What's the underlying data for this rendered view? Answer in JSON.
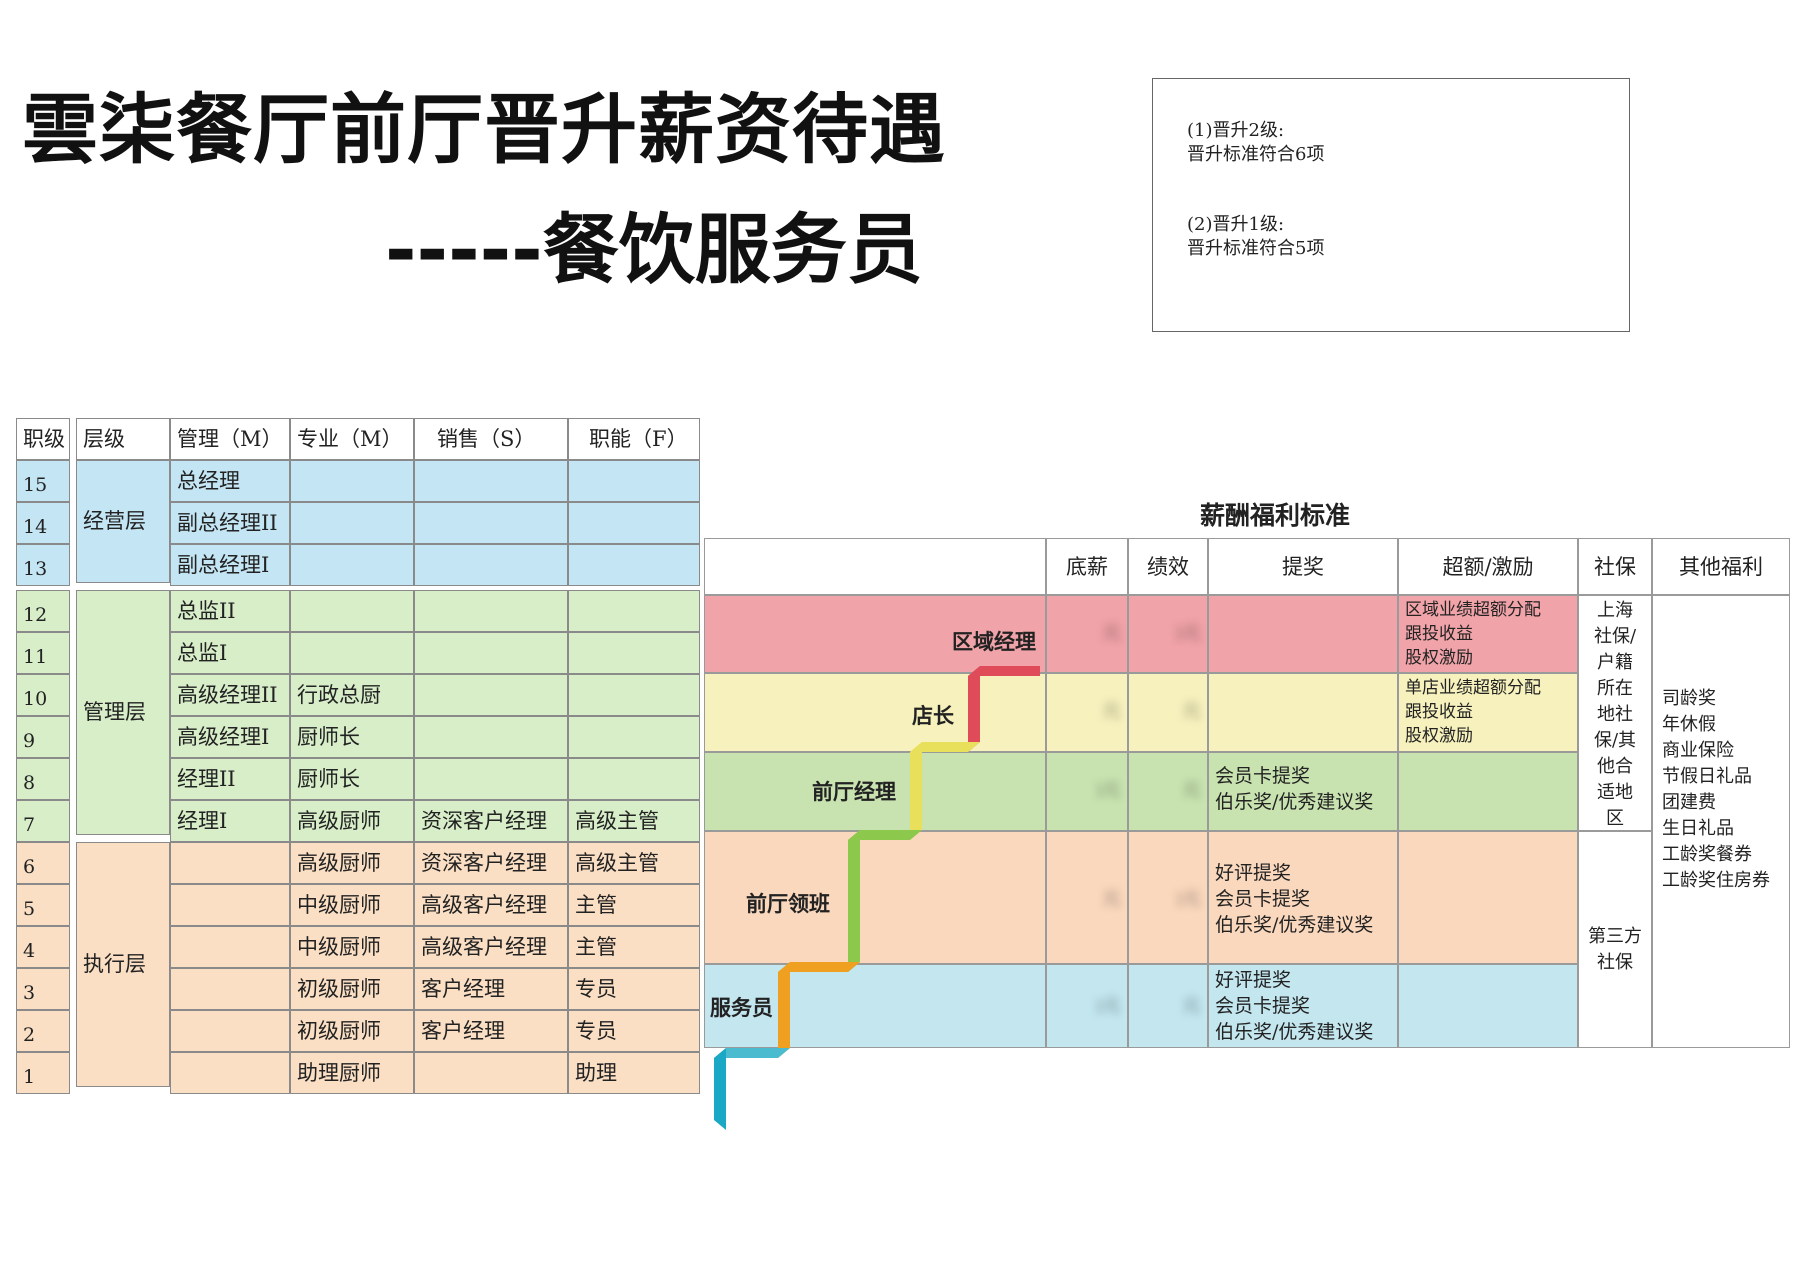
{
  "title": {
    "line1": "雲柒餐厅前厅晋升薪资待遇",
    "line2": "-----餐饮服务员"
  },
  "notes": {
    "note1": "(1)晋升2级:\n晋升标准符合6项",
    "note2": "(2)晋升1级:\n晋升标准符合5项"
  },
  "grade_table": {
    "headers": [
      "职级",
      "层级",
      "管理（M）",
      "专业（M）",
      "销售（S）",
      "职能（F）"
    ],
    "groups": [
      {
        "name": "经营层",
        "color": "blue"
      },
      {
        "name": "管理层",
        "color": "green"
      },
      {
        "name": "执行层",
        "color": "peach"
      }
    ],
    "rows": [
      {
        "grade": "15",
        "m": "总经理",
        "p": "",
        "s": "",
        "f": ""
      },
      {
        "grade": "14",
        "m": "副总经理II",
        "p": "",
        "s": "",
        "f": ""
      },
      {
        "grade": "13",
        "m": "副总经理I",
        "p": "",
        "s": "",
        "f": ""
      },
      {
        "grade": "12",
        "m": "总监II",
        "p": "",
        "s": "",
        "f": ""
      },
      {
        "grade": "11",
        "m": "总监I",
        "p": "",
        "s": "",
        "f": ""
      },
      {
        "grade": "10",
        "m": "高级经理II",
        "p": "行政总厨",
        "s": "",
        "f": ""
      },
      {
        "grade": "9",
        "m": "高级经理I",
        "p": "厨师长",
        "s": "",
        "f": ""
      },
      {
        "grade": "8",
        "m": "经理II",
        "p": "厨师长",
        "s": "",
        "f": ""
      },
      {
        "grade": "7",
        "m": "经理I",
        "p": "高级厨师",
        "s": "资深客户经理",
        "f": "高级主管"
      },
      {
        "grade": "6",
        "m": "",
        "p": "高级厨师",
        "s": "资深客户经理",
        "f": "高级主管"
      },
      {
        "grade": "5",
        "m": "",
        "p": "中级厨师",
        "s": "高级客户经理",
        "f": "主管"
      },
      {
        "grade": "4",
        "m": "",
        "p": "中级厨师",
        "s": "高级客户经理",
        "f": "主管"
      },
      {
        "grade": "3",
        "m": "",
        "p": "初级厨师",
        "s": "客户经理",
        "f": "专员"
      },
      {
        "grade": "2",
        "m": "",
        "p": "初级厨师",
        "s": "客户经理",
        "f": "专员"
      },
      {
        "grade": "1",
        "m": "",
        "p": "助理厨师",
        "s": "",
        "f": "助理"
      }
    ]
  },
  "salary_table": {
    "title": "薪酬福利标准",
    "headers": [
      "底薪",
      "绩效",
      "提奖",
      "超额/激励",
      "社保",
      "其他福利"
    ],
    "rows": [
      {
        "level": "区域经理",
        "base": "元",
        "perf": ")元",
        "bonus": "",
        "incentive": "区域业绩超额分配\n跟投收益\n股权激励"
      },
      {
        "level": "店长",
        "base": "元",
        "perf": "元",
        "bonus": "",
        "incentive": "单店业绩超额分配\n跟投收益\n股权激励"
      },
      {
        "level": "前厅经理",
        "base": ")元",
        "perf": "元",
        "bonus": "会员卡提奖\n伯乐奖/优秀建议奖",
        "incentive": ""
      },
      {
        "level": "前厅领班",
        "base": "元",
        "perf": ")元",
        "bonus": "好评提奖\n会员卡提奖\n伯乐奖/优秀建议奖",
        "incentive": ""
      },
      {
        "level": "服务员",
        "base": ")元",
        "perf": "元",
        "bonus": "好评提奖\n会员卡提奖\n伯乐奖/优秀建议奖",
        "incentive": ""
      }
    ],
    "social_insurance": {
      "upper": "上海\n社保/\n户籍\n所在\n地社\n保/其\n他合\n适地\n区",
      "lower": "第三方\n社保"
    },
    "other_benefits": "司龄奖\n年休假\n商业保险\n节假日礼品\n团建费\n生日礼品\n工龄奖餐券\n工龄奖住房券"
  },
  "colors": {
    "blue": "#c4e5f4",
    "green": "#d7eec9",
    "peach": "#fadfc4",
    "row_red": "#f0a3a8",
    "row_yellow": "#f6f1bd",
    "row_green": "#c8e3b0",
    "row_peach": "#fad8bd",
    "row_blue": "#c3e6ef"
  }
}
